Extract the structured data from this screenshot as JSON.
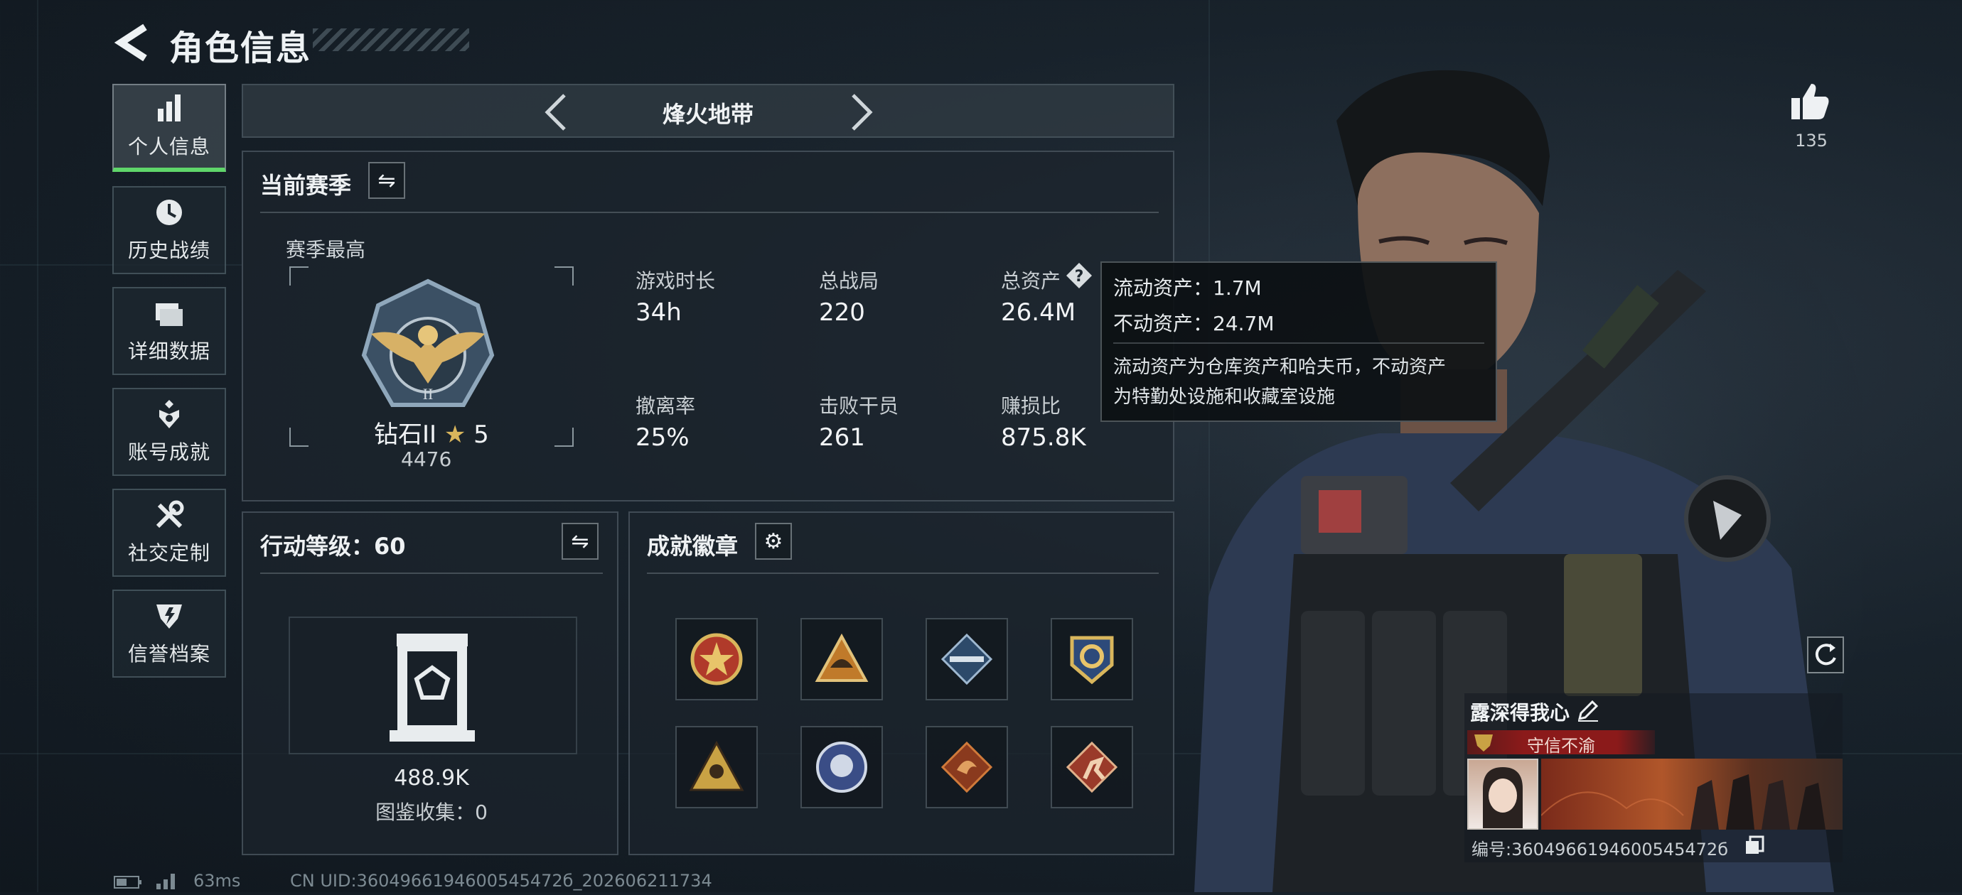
{
  "header": {
    "title": "角色信息"
  },
  "nav": [
    {
      "label": "个人信息",
      "icon": "bar-chart-icon",
      "active": true
    },
    {
      "label": "历史战绩",
      "icon": "clock-icon"
    },
    {
      "label": "详细数据",
      "icon": "folders-icon"
    },
    {
      "label": "账号成就",
      "icon": "achievement-icon"
    },
    {
      "label": "社交定制",
      "icon": "tools-icon"
    },
    {
      "label": "信誉档案",
      "icon": "shield-rank-icon"
    }
  ],
  "mode_selector": {
    "label": "烽火地带"
  },
  "season": {
    "title": "当前赛季",
    "best_label": "赛季最高",
    "rank_name": "钻石II",
    "rank_stars": "5",
    "rank_score": "4476",
    "stats": [
      {
        "label": "游戏时长",
        "value": "34h"
      },
      {
        "label": "总战局",
        "value": "220"
      },
      {
        "label": "总资产",
        "value": "26.4M"
      },
      {
        "label": "撤离率",
        "value": "25%"
      },
      {
        "label": "击败干员",
        "value": "261"
      },
      {
        "label": "赚损比",
        "value": "875.8K"
      }
    ]
  },
  "tooltip": {
    "line1": "流动资产：1.7M",
    "line2": "不动资产：24.7M",
    "desc1": "流动资产为仓库资产和哈夫币，不动资产",
    "desc2": "为特勤处设施和收藏室设施"
  },
  "action_level": {
    "title": "行动等级：60",
    "value": "488.9K",
    "collection": "图鉴收集：0"
  },
  "achievements": {
    "title": "成就徽章",
    "badges": [
      "star-emblem-icon",
      "helmet-emblem-icon",
      "rifle-emblem-icon",
      "gear-emblem-icon",
      "soldier-emblem-icon",
      "bulldog-emblem-icon",
      "dragon-emblem-icon",
      "runner-emblem-icon"
    ]
  },
  "likes": {
    "count": "135"
  },
  "profile": {
    "name": "露深得我心",
    "honor": "守信不渝",
    "id_text": "编号:3604966194600545472б"
  },
  "footer": {
    "ping": "63ms",
    "uid": "CN UID:3604966194600545472б_202606211734"
  },
  "colors": {
    "accent_green": "#5fd66a",
    "honor_red": "#8b1a1a",
    "panel_border": "#6e7d87"
  }
}
